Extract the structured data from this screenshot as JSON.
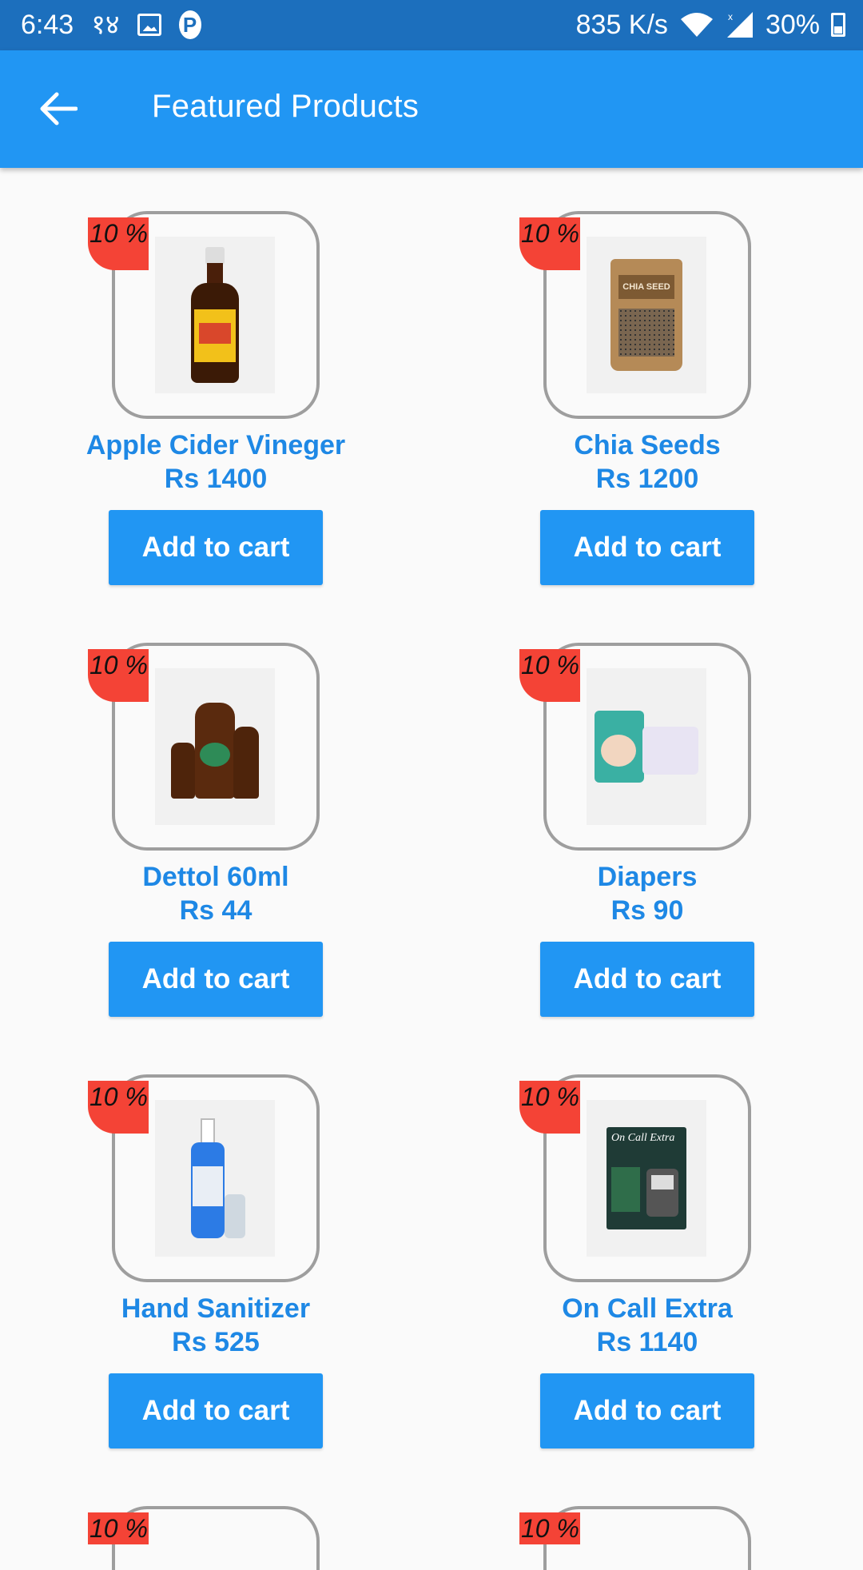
{
  "status_bar": {
    "time": "6:43",
    "left_glyph": "१४",
    "net_speed": "835 K/s",
    "signal_x": "x",
    "battery": "30%"
  },
  "app_bar": {
    "title": "Featured Products"
  },
  "products": [
    {
      "name": "Apple Cider Vineger",
      "price": "Rs 1400",
      "badge": "10 %",
      "button": "Add to cart"
    },
    {
      "name": "Chia Seeds",
      "price": "Rs 1200",
      "badge": "10 %",
      "button": "Add to cart"
    },
    {
      "name": "Dettol 60ml",
      "price": "Rs 44",
      "badge": "10 %",
      "button": "Add to cart"
    },
    {
      "name": "Diapers",
      "price": "Rs 90",
      "badge": "10 %",
      "button": "Add to cart"
    },
    {
      "name": "Hand Sanitizer",
      "price": "Rs 525",
      "badge": "10 %",
      "button": "Add to cart"
    },
    {
      "name": "On Call Extra",
      "price": "Rs 1140",
      "badge": "10 %",
      "button": "Add to cart"
    }
  ],
  "partial_products": [
    {
      "badge": "10 %"
    },
    {
      "badge": "10 %"
    }
  ],
  "product_image_labels": {
    "chia": "CHIA SEED",
    "oncall": "On Call Extra"
  },
  "colors": {
    "status_bar": "#1c6fbd",
    "app_bar": "#2196f3",
    "text_accent": "#1e88e5",
    "badge": "#f44336",
    "frame": "#9e9e9e",
    "background": "#fafafa"
  }
}
